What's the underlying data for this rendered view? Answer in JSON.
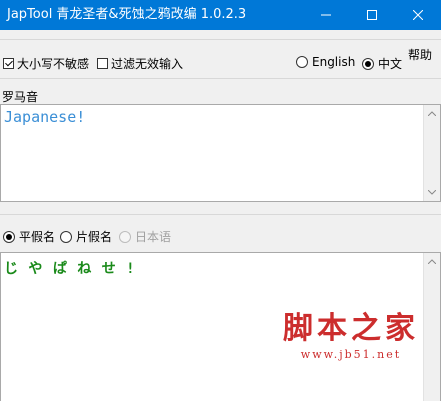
{
  "window": {
    "title": "JapTool 青龙圣者&死蚀之鸦改编 1.0.2.3"
  },
  "options": {
    "case_insensitive_label": "大小写不敏感",
    "case_insensitive_checked": true,
    "filter_invalid_label": "过滤无效输入",
    "filter_invalid_checked": false
  },
  "language": {
    "english_label": "English",
    "chinese_label": "中文",
    "selected": "中文"
  },
  "help_label": "帮助",
  "romaji": {
    "label": "罗马音",
    "value": "Japanese!"
  },
  "script_mode": {
    "hiragana_label": "平假名",
    "katakana_label": "片假名",
    "japanese_label": "日本语",
    "selected": "平假名"
  },
  "output": {
    "value": "じ や ぱ ね せ !"
  },
  "watermark": {
    "main": "脚本之家",
    "url": "www.jb51.net"
  },
  "colors": {
    "titlebar": "#0078d7",
    "romaji_text": "#3b8fd6",
    "kana_text": "#1a8a1a",
    "watermark": "#cc2d2d"
  }
}
